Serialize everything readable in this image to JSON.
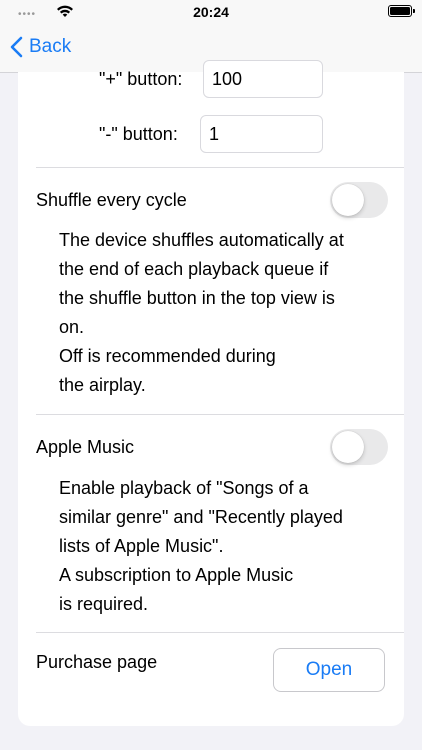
{
  "status_bar": {
    "time": "20:24",
    "signal_dots": "••••",
    "wifi_icon": "wifi-icon",
    "battery_icon": "battery-icon"
  },
  "nav": {
    "back_label": "Back",
    "back_icon": "chevron-left-icon"
  },
  "steps": {
    "plus_label": "\"+\" button:",
    "plus_value": "100",
    "minus_label": "\"-\" button:",
    "minus_value": "1"
  },
  "shuffle": {
    "title": "Shuffle every cycle",
    "enabled": false,
    "description": [
      "The device shuffles automatically at",
      "the end of each playback queue if",
      "the shuffle button in the top view is",
      "on.",
      "Off is recommended during",
      "the airplay."
    ]
  },
  "apple_music": {
    "title": "Apple Music",
    "enabled": false,
    "description": [
      "Enable playback of \"Songs of a",
      "similar genre\" and \"Recently played",
      "lists of Apple Music\".",
      "A subscription to Apple Music",
      "is required."
    ]
  },
  "purchase": {
    "label": "Purchase page",
    "button_label": "Open"
  },
  "colors": {
    "accent": "#1a7cf5",
    "background": "#f2f2f7",
    "toggle_off": "#e9e9ea"
  }
}
